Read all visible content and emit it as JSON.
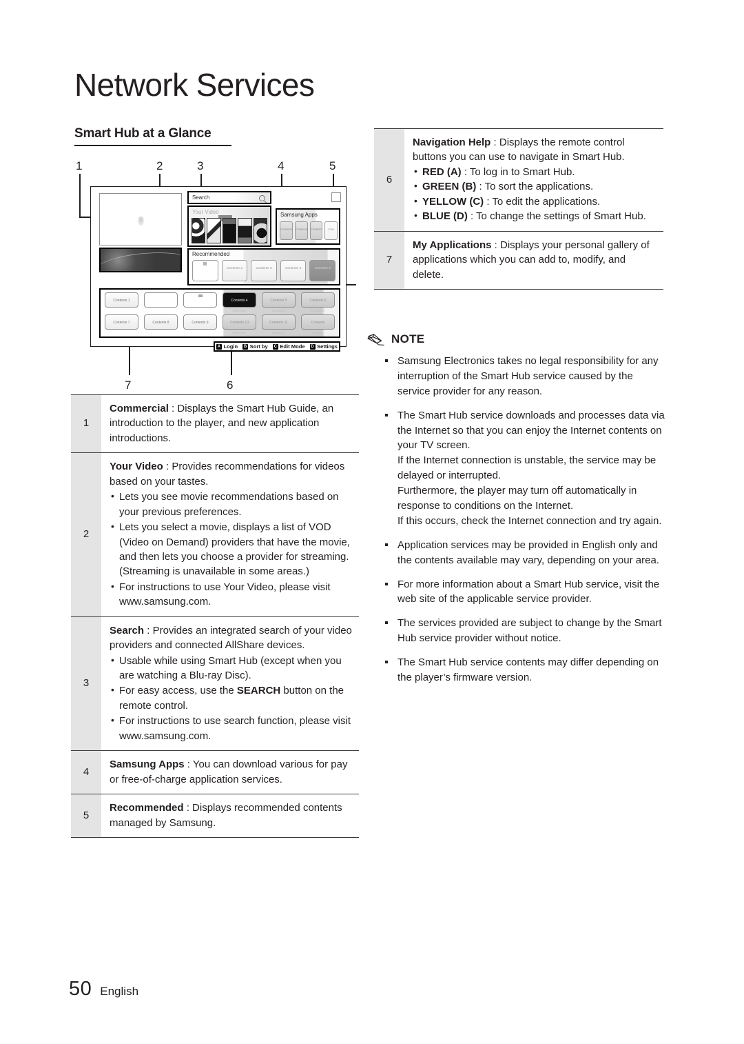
{
  "page": {
    "chapter_title": "Network Services",
    "section_title": "Smart Hub at a Glance",
    "footer_page_number": "50",
    "footer_language": "English"
  },
  "figure": {
    "callouts_top": [
      "1",
      "2",
      "3",
      "4",
      "5"
    ],
    "callouts_bottom": [
      "7",
      "6"
    ],
    "hub": {
      "search_label": "Search",
      "search_icon": "magnifier-icon",
      "your_video_label": "Your Video",
      "samsung_apps_label": "Samsung Apps",
      "samsung_apps_tiles": [
        "Contents 1",
        "Contents 2",
        "Contents 3",
        "Con"
      ],
      "recommended_label": "Recommended",
      "recommended_tiles": [
        "",
        "Contents 2",
        "Contents 3",
        "Contents 4",
        "Contents 5"
      ],
      "my_applications_tiles": [
        {
          "label": "Contents 1",
          "caption": ""
        },
        {
          "label": "",
          "caption": ""
        },
        {
          "label": "",
          "caption": ""
        },
        {
          "label": "Contents 4",
          "caption": "xxxxxxxx"
        },
        {
          "label": "Contents 5",
          "caption": "xxxxxxxx"
        },
        {
          "label": "Contents 6",
          "caption": "xxxxxxxx"
        },
        {
          "label": "Contents 7",
          "caption": ""
        },
        {
          "label": "Contents 8",
          "caption": ""
        },
        {
          "label": "Contents 9",
          "caption": ""
        },
        {
          "label": "Contents 10",
          "caption": "xxxxxxxx"
        },
        {
          "label": "Contents 11",
          "caption": "xxxxxxxx"
        },
        {
          "label": "Contents",
          "caption": "xxxxxx"
        }
      ],
      "nav_help": [
        {
          "key": "A",
          "label": "Login"
        },
        {
          "key": "B",
          "label": "Sort by"
        },
        {
          "key": "C",
          "label": "Edit Mode"
        },
        {
          "key": "D",
          "label": "Settings"
        }
      ]
    }
  },
  "left_table": {
    "rows": [
      {
        "index": "1",
        "term": "Commercial",
        "sep": " : ",
        "desc": "Displays the Smart Hub Guide, an introduction to the player, and new application introductions.",
        "bullets": []
      },
      {
        "index": "2",
        "term": "Your Video",
        "sep": " : ",
        "desc": "Provides recommendations for videos based on your tastes.",
        "bullets": [
          "Lets you see movie recommendations based on your previous preferences.",
          "Lets you select a movie, displays a list of VOD (Video on Demand) providers that have the movie, and then lets you choose a provider for streaming. (Streaming is unavailable in some areas.)",
          "For instructions to use Your Video, please visit www.samsung.com."
        ]
      },
      {
        "index": "3",
        "term": "Search",
        "sep": " : ",
        "desc": "Provides an integrated search of your video providers and connected AllShare devices.",
        "bullets": [
          "Usable while using Smart Hub (except when you are watching a Blu-ray Disc).",
          "For easy access, use the SEARCH button on the remote control.",
          "For instructions to use search function, please visit www.samsung.com."
        ],
        "bullet_bold_word": "SEARCH"
      },
      {
        "index": "4",
        "term": "Samsung Apps",
        "sep": " : ",
        "desc": "You can download various for pay or free-of-charge application services.",
        "bullets": []
      },
      {
        "index": "5",
        "term": "Recommended",
        "sep": " : ",
        "desc": "Displays recommended contents managed by Samsung.",
        "bullets": []
      }
    ]
  },
  "right_table": {
    "rows": [
      {
        "index": "6",
        "term": "Navigation Help",
        "sep": " : ",
        "desc": "Displays the remote control buttons you can use to navigate in Smart Hub.",
        "bullets": [
          {
            "bold": "RED (A)",
            "rest": " : To log in to Smart Hub."
          },
          {
            "bold": "GREEN (B)",
            "rest": " : To sort the applications."
          },
          {
            "bold": "YELLOW (C)",
            "rest": " : To edit the applications."
          },
          {
            "bold": "BLUE (D)",
            "rest": " : To change the settings of Smart Hub."
          }
        ]
      },
      {
        "index": "7",
        "term": "My Applications",
        "sep": " : ",
        "desc": "Displays your personal gallery of applications which you can add to, modify, and delete.",
        "bullets": []
      }
    ]
  },
  "note": {
    "icon": "pencil-icon",
    "label": "NOTE",
    "items": [
      [
        "Samsung Electronics takes no legal responsibility for any interruption of the Smart Hub service caused by the service provider for any reason."
      ],
      [
        "The Smart Hub service downloads and processes data via the Internet so that you can enjoy the Internet contents on your TV screen.",
        "If the Internet connection is unstable, the service may be delayed or interrupted.",
        "Furthermore, the player may turn off automatically in response to conditions on the Internet.",
        "If this occurs, check the Internet connection and try again."
      ],
      [
        "Application services may be provided in English only and the contents available may vary, depending on your area."
      ],
      [
        "For more information about a Smart Hub service, visit the web site of the applicable service provider."
      ],
      [
        "The services provided are subject to change by the Smart Hub service provider without notice."
      ],
      [
        "The Smart Hub service contents may differ depending on the player’s firmware version."
      ]
    ]
  }
}
